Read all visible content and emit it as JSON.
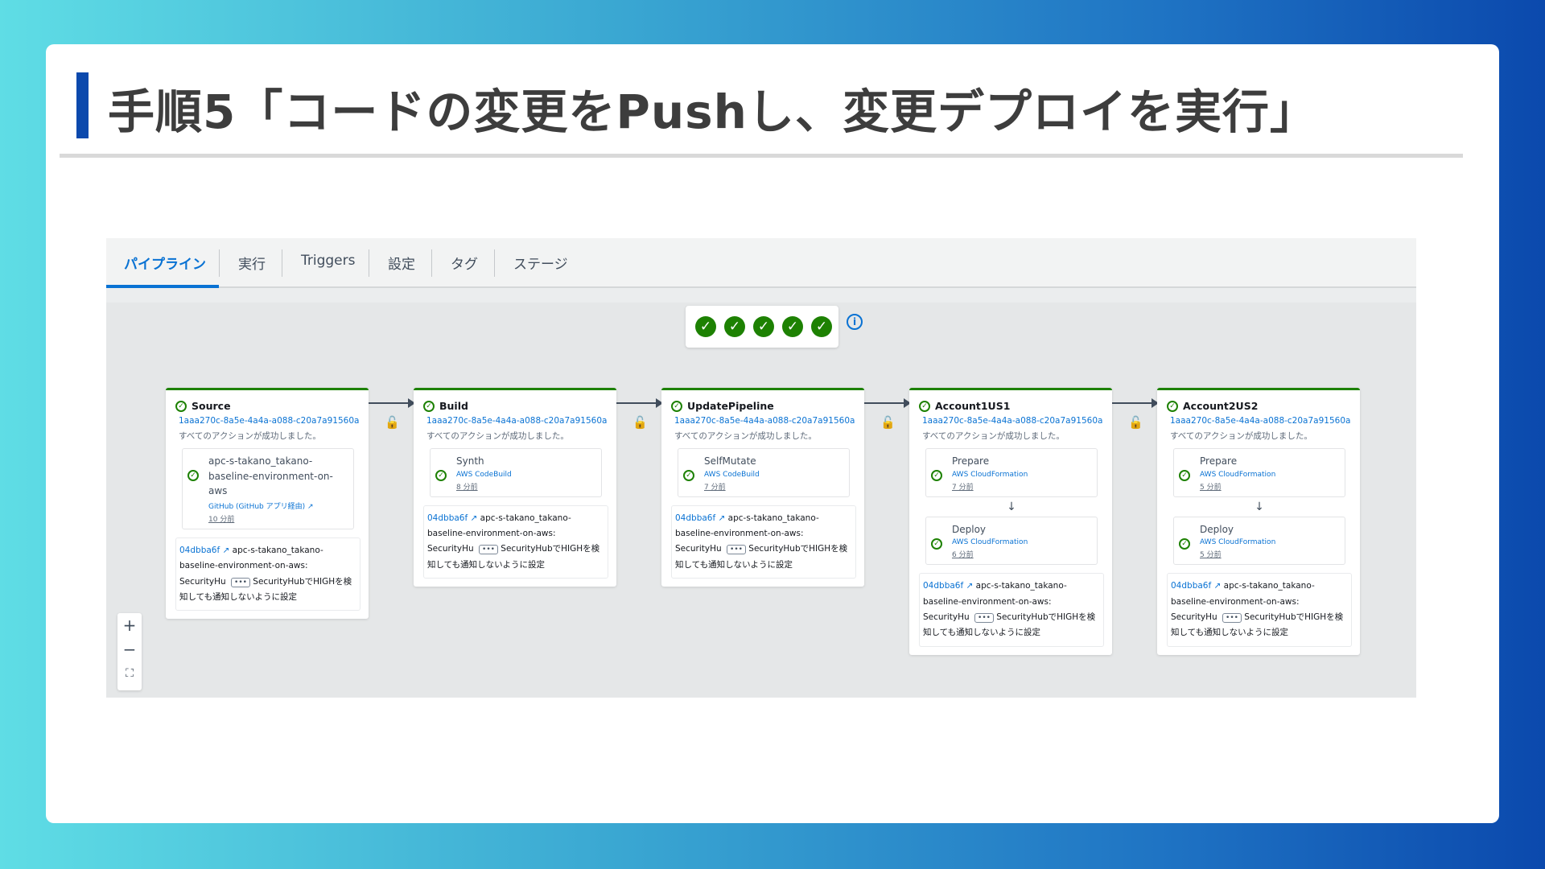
{
  "slide": {
    "title": "手順5「コードの変更をPushし、変更デプロイを実行」"
  },
  "console": {
    "tabs": [
      {
        "label": "パイプライン",
        "active": true
      },
      {
        "label": "実行"
      },
      {
        "label": "Triggers"
      },
      {
        "label": "設定"
      },
      {
        "label": "タグ"
      },
      {
        "label": "ステージ"
      }
    ],
    "summary_icons": [
      "check-circle-icon",
      "check-circle-icon",
      "check-circle-icon",
      "check-circle-icon",
      "check-circle-icon"
    ],
    "info_label": "i",
    "stages": [
      {
        "name": "Source",
        "execution_id": "1aaa270c-8a5e-4a4a-a088-c20a7a91560a",
        "message": "すべてのアクションが成功しました。",
        "actions": [
          {
            "name": "apc-s-takano_takano-baseline-environment-on-aws",
            "provider": "GitHub (GitHub アプリ経由)",
            "time": "10 分前"
          }
        ],
        "commit": {
          "hash": "04dbba6f",
          "text": "apc-s-takano_takano-baseline-environment-on-aws: SecurityHu",
          "more": "•••",
          "message": "SecurityHubでHIGHを検知しても通知しないように設定"
        }
      },
      {
        "name": "Build",
        "execution_id": "1aaa270c-8a5e-4a4a-a088-c20a7a91560a",
        "message": "すべてのアクションが成功しました。",
        "actions": [
          {
            "name": "Synth",
            "provider": "AWS CodeBuild",
            "time": "8 分前"
          }
        ],
        "commit": {
          "hash": "04dbba6f",
          "text": "apc-s-takano_takano-baseline-environment-on-aws: SecurityHu",
          "more": "•••",
          "message": "SecurityHubでHIGHを検知しても通知しないように設定"
        }
      },
      {
        "name": "UpdatePipeline",
        "execution_id": "1aaa270c-8a5e-4a4a-a088-c20a7a91560a",
        "message": "すべてのアクションが成功しました。",
        "actions": [
          {
            "name": "SelfMutate",
            "provider": "AWS CodeBuild",
            "time": "7 分前"
          }
        ],
        "commit": {
          "hash": "04dbba6f",
          "text": "apc-s-takano_takano-baseline-environment-on-aws: SecurityHu",
          "more": "•••",
          "message": "SecurityHubでHIGHを検知しても通知しないように設定"
        }
      },
      {
        "name": "Account1US1",
        "execution_id": "1aaa270c-8a5e-4a4a-a088-c20a7a91560a",
        "message": "すべてのアクションが成功しました。",
        "actions": [
          {
            "name": "Prepare",
            "provider": "AWS CloudFormation",
            "time": "7 分前"
          },
          {
            "name": "Deploy",
            "provider": "AWS CloudFormation",
            "time": "6 分前"
          }
        ],
        "commit": {
          "hash": "04dbba6f",
          "text": "apc-s-takano_takano-baseline-environment-on-aws: SecurityHu",
          "more": "•••",
          "message": "SecurityHubでHIGHを検知しても通知しないように設定"
        }
      },
      {
        "name": "Account2US2",
        "execution_id": "1aaa270c-8a5e-4a4a-a088-c20a7a91560a",
        "message": "すべてのアクションが成功しました。",
        "actions": [
          {
            "name": "Prepare",
            "provider": "AWS CloudFormation",
            "time": "5 分前"
          },
          {
            "name": "Deploy",
            "provider": "AWS CloudFormation",
            "time": "5 分前"
          }
        ],
        "commit": {
          "hash": "04dbba6f",
          "text": "apc-s-takano_takano-baseline-environment-on-aws: SecurityHu",
          "more": "•••",
          "message": "SecurityHubでHIGHを検知しても通知しないように設定"
        }
      }
    ],
    "zoom": {
      "in": "+",
      "out": "−",
      "fit": "⛶"
    },
    "colors": {
      "accent": "#0972d3",
      "success": "#1d8102",
      "slide_bar": "#0b49ad"
    }
  }
}
